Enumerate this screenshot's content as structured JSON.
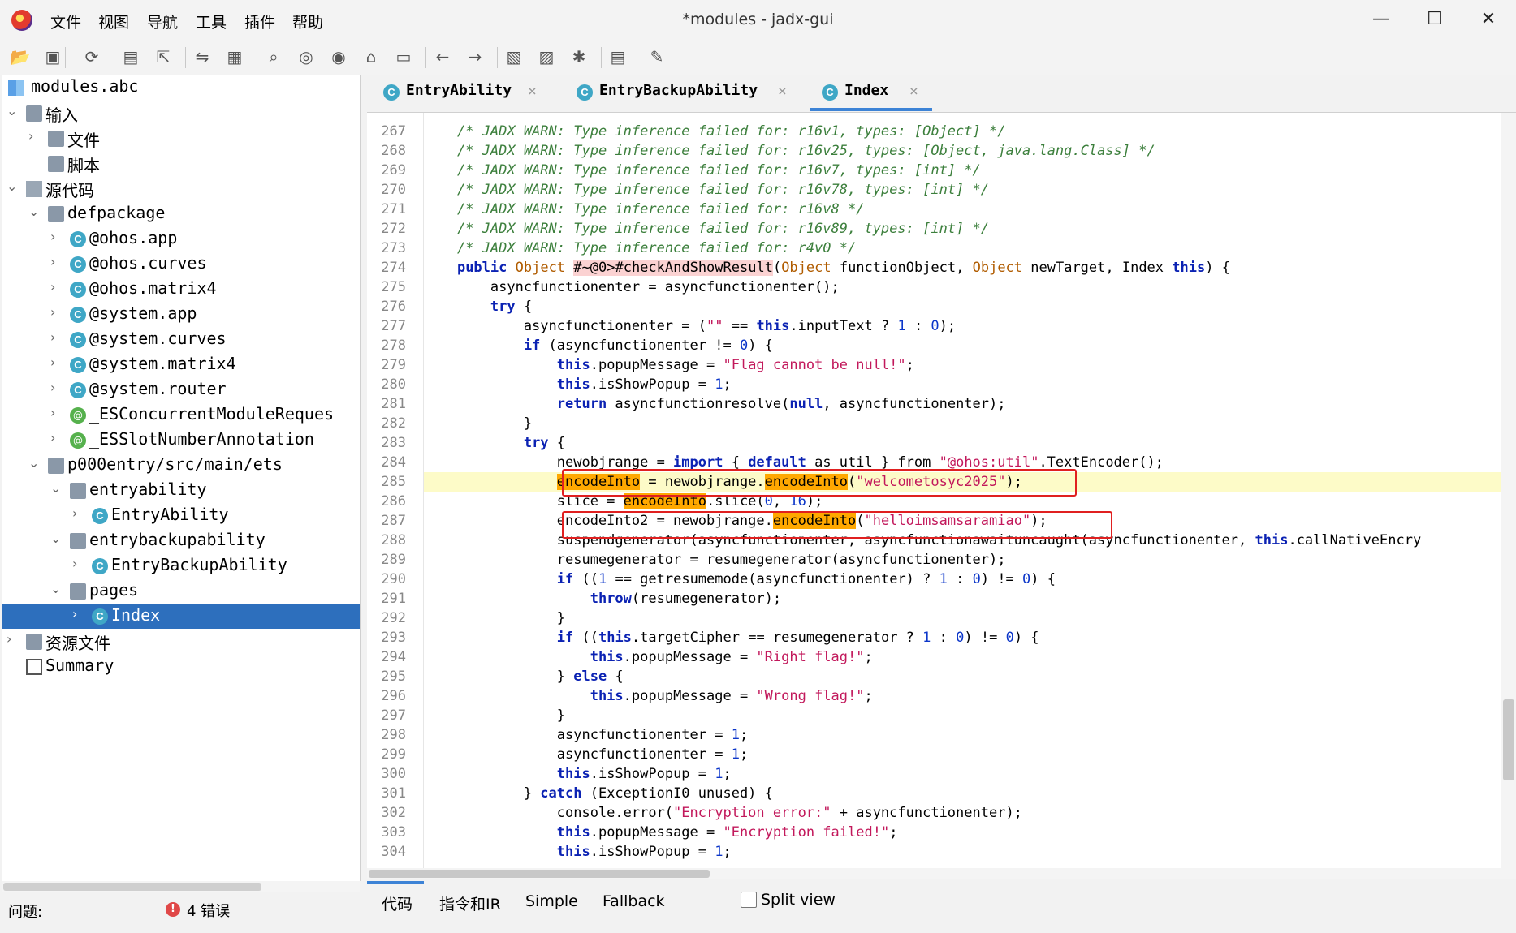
{
  "window": {
    "title": "*modules - jadx-gui",
    "minimize": "—",
    "maximize": "☐",
    "close": "✕"
  },
  "menu": [
    "文件",
    "视图",
    "导航",
    "工具",
    "插件",
    "帮助"
  ],
  "toolbar_icons": [
    "open-file-icon",
    "add-file-icon",
    "reload-icon",
    "save-icon",
    "export-icon",
    "sync-icon",
    "collapse-icon",
    "search-icon",
    "find-class-icon",
    "find-usage-icon",
    "home-icon",
    "deobfuscation-icon",
    "back-icon",
    "forward-icon",
    "quark-icon",
    "log-icon",
    "debug-icon",
    "settings-list-icon",
    "preferences-icon"
  ],
  "tree": {
    "root": "modules.abc",
    "items": [
      {
        "label": "输入",
        "indent": 0,
        "arrow": "down",
        "icon": "folder"
      },
      {
        "label": "文件",
        "indent": 1,
        "arrow": "right",
        "icon": "folder"
      },
      {
        "label": "脚本",
        "indent": 1,
        "arrow": "",
        "icon": "folder"
      },
      {
        "label": "源代码",
        "indent": 0,
        "arrow": "down",
        "icon": "package"
      },
      {
        "label": "defpackage",
        "indent": 1,
        "arrow": "down",
        "icon": "folder",
        "mono": true
      },
      {
        "label": "@ohos.app",
        "indent": 2,
        "arrow": "right",
        "icon": "class",
        "mono": true
      },
      {
        "label": "@ohos.curves",
        "indent": 2,
        "arrow": "right",
        "icon": "class",
        "mono": true
      },
      {
        "label": "@ohos.matrix4",
        "indent": 2,
        "arrow": "right",
        "icon": "class",
        "mono": true
      },
      {
        "label": "@system.app",
        "indent": 2,
        "arrow": "right",
        "icon": "class",
        "mono": true
      },
      {
        "label": "@system.curves",
        "indent": 2,
        "arrow": "right",
        "icon": "class",
        "mono": true
      },
      {
        "label": "@system.matrix4",
        "indent": 2,
        "arrow": "right",
        "icon": "class",
        "mono": true
      },
      {
        "label": "@system.router",
        "indent": 2,
        "arrow": "right",
        "icon": "class",
        "mono": true
      },
      {
        "label": "_ESConcurrentModuleReques",
        "indent": 2,
        "arrow": "right",
        "icon": "anno",
        "mono": true
      },
      {
        "label": "_ESSlotNumberAnnotation",
        "indent": 2,
        "arrow": "right",
        "icon": "anno",
        "mono": true
      },
      {
        "label": "p000entry/src/main/ets",
        "indent": 1,
        "arrow": "down",
        "icon": "folder",
        "mono": true
      },
      {
        "label": "entryability",
        "indent": 2,
        "arrow": "down",
        "icon": "folder",
        "mono": true
      },
      {
        "label": "EntryAbility",
        "indent": 3,
        "arrow": "right",
        "icon": "class",
        "mono": true
      },
      {
        "label": "entrybackupability",
        "indent": 2,
        "arrow": "down",
        "icon": "folder",
        "mono": true
      },
      {
        "label": "EntryBackupAbility",
        "indent": 3,
        "arrow": "right",
        "icon": "class",
        "mono": true
      },
      {
        "label": "pages",
        "indent": 2,
        "arrow": "down",
        "icon": "folder",
        "mono": true
      },
      {
        "label": "Index",
        "indent": 3,
        "arrow": "right",
        "icon": "class",
        "mono": true,
        "selected": true
      },
      {
        "label": "资源文件",
        "indent": 0,
        "arrow": "right",
        "icon": "folder"
      },
      {
        "label": "Summary",
        "indent": 0,
        "arrow": "",
        "icon": "summary",
        "mono": true
      }
    ]
  },
  "tabs": [
    {
      "label": "EntryAbility",
      "close": "×"
    },
    {
      "label": "EntryBackupAbility",
      "close": "×"
    },
    {
      "label": "Index",
      "close": "×",
      "active": true
    }
  ],
  "code_lines": [
    {
      "n": "267",
      "html": "    <span class='c-com'>/* JADX WARN: Type inference failed for: r16v1, types: [Object] */</span>"
    },
    {
      "n": "268",
      "html": "    <span class='c-com'>/* JADX WARN: Type inference failed for: r16v25, types: [Object, java.lang.Class] */</span>"
    },
    {
      "n": "269",
      "html": "    <span class='c-com'>/* JADX WARN: Type inference failed for: r16v7, types: [int] */</span>"
    },
    {
      "n": "270",
      "html": "    <span class='c-com'>/* JADX WARN: Type inference failed for: r16v78, types: [int] */</span>"
    },
    {
      "n": "271",
      "html": "    <span class='c-com'>/* JADX WARN: Type inference failed for: r16v8 */</span>"
    },
    {
      "n": "272",
      "html": "    <span class='c-com'>/* JADX WARN: Type inference failed for: r16v89, types: [int] */</span>"
    },
    {
      "n": "273",
      "html": "    <span class='c-com'>/* JADX WARN: Type inference failed for: r4v0 */</span>"
    },
    {
      "n": "274",
      "html": "    <span class='c-kw'>public</span> <span class='c-type'>Object</span> <span class='c-err'>#~@0&gt;#checkAndShowResult</span>(<span class='c-type'>Object</span> functionObject, <span class='c-type'>Object</span> newTarget, Index <span class='c-kw'>this</span>) {"
    },
    {
      "n": "275",
      "html": "        asyncfunctionenter = asyncfunctionenter();"
    },
    {
      "n": "276",
      "html": "        <span class='c-kw'>try</span> {"
    },
    {
      "n": "277",
      "html": "            asyncfunctionenter = (<span class='c-str'>\"\"</span> == <span class='c-kw'>this</span>.inputText ? <span class='c-num'>1</span> : <span class='c-num'>0</span>);"
    },
    {
      "n": "278",
      "html": "            <span class='c-kw'>if</span> (asyncfunctionenter != <span class='c-num'>0</span>) {"
    },
    {
      "n": "279",
      "html": "                <span class='c-kw'>this</span>.popupMessage = <span class='c-str'>\"Flag cannot be null!\"</span>;"
    },
    {
      "n": "280",
      "html": "                <span class='c-kw'>this</span>.isShowPopup = <span class='c-num'>1</span>;"
    },
    {
      "n": "281",
      "html": "                <span class='c-kw'>return</span> asyncfunctionresolve(<span class='c-kw'>null</span>, asyncfunctionenter);"
    },
    {
      "n": "282",
      "html": "            }"
    },
    {
      "n": "283",
      "html": "            <span class='c-kw'>try</span> {"
    },
    {
      "n": "284",
      "html": "                newobjrange = <span class='c-kw'>import</span> { <span class='c-kw'>default</span> as util } from <span class='c-str'>\"@ohos:util\"</span>.TextEncoder();"
    },
    {
      "n": "285",
      "hl": true,
      "html": "                <span class='c-hl'>encodeInto</span> = newobjrange.<span class='c-hl'>encodeInto</span>(<span class='c-str'>\"welcometosyc2025\"</span>);"
    },
    {
      "n": "286",
      "html": "                slice = <span class='c-hl'>encodeInto</span>.slice(<span class='c-num'>0</span>, <span class='c-num'>16</span>);"
    },
    {
      "n": "287",
      "html": "                encodeInto2 = newobjrange.<span class='c-hl'>encodeInto</span>(<span class='c-str'>\"helloimsamsaramiao\"</span>);"
    },
    {
      "n": "288",
      "html": "                suspendgenerator(asyncfunctionenter, asyncfunctionawaituncaught(asyncfunctionenter, <span class='c-kw'>this</span>.callNativeEncry"
    },
    {
      "n": "289",
      "html": "                resumegenerator = resumegenerator(asyncfunctionenter);"
    },
    {
      "n": "290",
      "html": "                <span class='c-kw'>if</span> ((<span class='c-num'>1</span> == getresumemode(asyncfunctionenter) ? <span class='c-num'>1</span> : <span class='c-num'>0</span>) != <span class='c-num'>0</span>) {"
    },
    {
      "n": "291",
      "html": "                    <span class='c-kw'>throw</span>(resumegenerator);"
    },
    {
      "n": "292",
      "html": "                }"
    },
    {
      "n": "293",
      "html": "                <span class='c-kw'>if</span> ((<span class='c-kw'>this</span>.targetCipher == resumegenerator ? <span class='c-num'>1</span> : <span class='c-num'>0</span>) != <span class='c-num'>0</span>) {"
    },
    {
      "n": "294",
      "html": "                    <span class='c-kw'>this</span>.popupMessage = <span class='c-str'>\"Right flag!\"</span>;"
    },
    {
      "n": "295",
      "html": "                } <span class='c-kw'>else</span> {"
    },
    {
      "n": "296",
      "html": "                    <span class='c-kw'>this</span>.popupMessage = <span class='c-str'>\"Wrong flag!\"</span>;"
    },
    {
      "n": "297",
      "html": "                }"
    },
    {
      "n": "298",
      "html": "                asyncfunctionenter = <span class='c-num'>1</span>;"
    },
    {
      "n": "299",
      "html": "                asyncfunctionenter = <span class='c-num'>1</span>;"
    },
    {
      "n": "300",
      "html": "                <span class='c-kw'>this</span>.isShowPopup = <span class='c-num'>1</span>;"
    },
    {
      "n": "301",
      "html": "            } <span class='c-kw'>catch</span> (ExceptionI0 unused) {"
    },
    {
      "n": "302",
      "html": "                console.error(<span class='c-str'>\"Encryption error:\"</span> + asyncfunctionenter);"
    },
    {
      "n": "303",
      "html": "                <span class='c-kw'>this</span>.popupMessage = <span class='c-str'>\"Encryption failed!\"</span>;"
    },
    {
      "n": "304",
      "html": "                <span class='c-kw'>this</span>.isShowPopup = <span class='c-num'>1</span>;"
    }
  ],
  "bottom_tabs": [
    "代码",
    "指令和IR",
    "Simple",
    "Fallback"
  ],
  "split_view_label": "Split view",
  "status": {
    "problems_label": "问题:",
    "error_count_label": "4 错误"
  },
  "colors": {
    "accent": "#2d6fbd",
    "highlight_token": "#ffa800",
    "red_box": "#e02020",
    "current_line": "#fdfbc8"
  }
}
